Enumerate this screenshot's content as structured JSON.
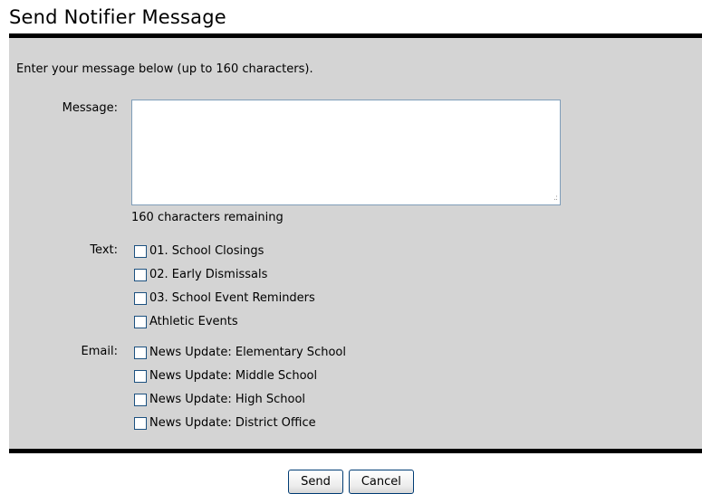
{
  "page": {
    "title": "Send Notifier Message"
  },
  "form": {
    "intro": "Enter your message below (up to 160 characters).",
    "message_label": "Message:",
    "message_value": "",
    "remaining": "160 characters remaining",
    "text_label": "Text:",
    "text_options": [
      {
        "label": "01. School Closings",
        "checked": false
      },
      {
        "label": "02. Early Dismissals",
        "checked": false
      },
      {
        "label": "03. School Event Reminders",
        "checked": false
      },
      {
        "label": "Athletic Events",
        "checked": false
      }
    ],
    "email_label": "Email:",
    "email_options": [
      {
        "label": "News Update: Elementary School",
        "checked": false
      },
      {
        "label": "News Update: Middle School",
        "checked": false
      },
      {
        "label": "News Update: High School",
        "checked": false
      },
      {
        "label": "News Update: District Office",
        "checked": false
      }
    ]
  },
  "buttons": {
    "send": "Send",
    "cancel": "Cancel"
  },
  "colors": {
    "panel_bg": "#d4d4d4",
    "rule": "#000000",
    "checkbox_border": "#1c5180",
    "textarea_border": "#7f9db9"
  }
}
